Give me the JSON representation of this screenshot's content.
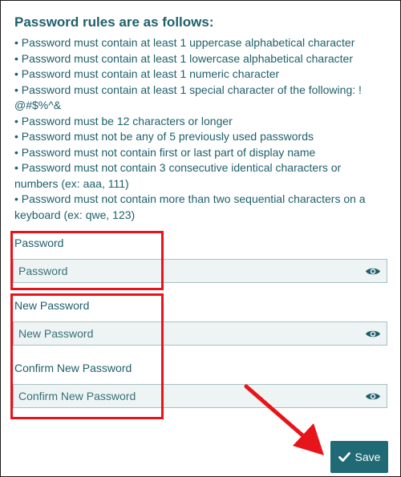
{
  "rules": {
    "title": "Password rules are as follows:",
    "items": [
      "Password must contain at least 1 uppercase alphabetical character",
      "Password must contain at least 1 lowercase alphabetical character",
      "Password must contain at least 1 numeric character",
      "Password must contain at least 1 special character of the following: ! @#$%^&",
      "Password must be 12 characters or longer",
      "Password must not be any of 5 previously used passwords",
      "Password must not contain first or last part of display name",
      "Password must not contain 3 consecutive identical characters or numbers (ex: aaa, 111)",
      "Password must not contain more than two sequential characters on a keyboard (ex: qwe, 123)"
    ]
  },
  "fields": {
    "password": {
      "label": "Password",
      "placeholder": "Password",
      "value": ""
    },
    "new_password": {
      "label": "New Password",
      "placeholder": "New Password",
      "value": ""
    },
    "confirm_password": {
      "label": "Confirm New Password",
      "placeholder": "Confirm New Password",
      "value": ""
    }
  },
  "actions": {
    "save_label": "Save"
  },
  "icons": {
    "reveal": "eye-icon",
    "save": "check-icon"
  },
  "colors": {
    "text": "#1f5f6b",
    "button": "#1f6a74",
    "input_bg": "#eef4f4",
    "annotation": "#e8141b"
  }
}
